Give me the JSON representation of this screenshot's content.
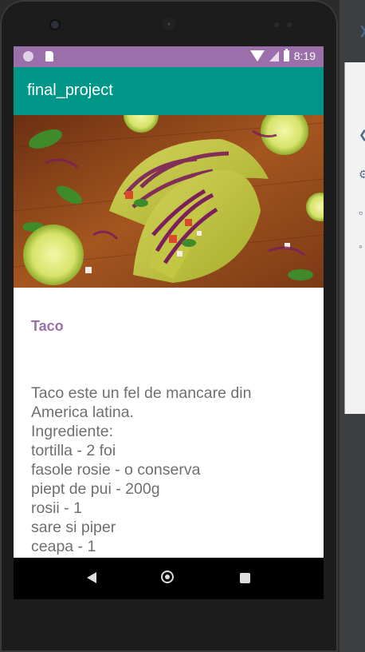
{
  "colors": {
    "status_bar": "#9b6fa9",
    "app_bar": "#009688",
    "title_accent": "#9b6fa9",
    "body_text": "#6f6f6f"
  },
  "status_bar": {
    "time": "8:19",
    "icons": [
      "notification-circle-icon",
      "sd-card-icon",
      "wifi-icon",
      "signal-icon",
      "battery-icon"
    ]
  },
  "app_bar": {
    "title": "final_project"
  },
  "hero_image": {
    "subject": "tacos-photo"
  },
  "recipe": {
    "title": "Taco",
    "description": "Taco este un fel de mancare din America latina.\nIngrediente:\ntortilla - 2 foi\nfasole rosie - o conserva\npiept de pui - 200g\nrosii - 1\nsare si piper\nceapa - 1"
  },
  "nav_bar": {
    "icons": [
      "back-icon",
      "home-icon",
      "recents-icon"
    ]
  }
}
